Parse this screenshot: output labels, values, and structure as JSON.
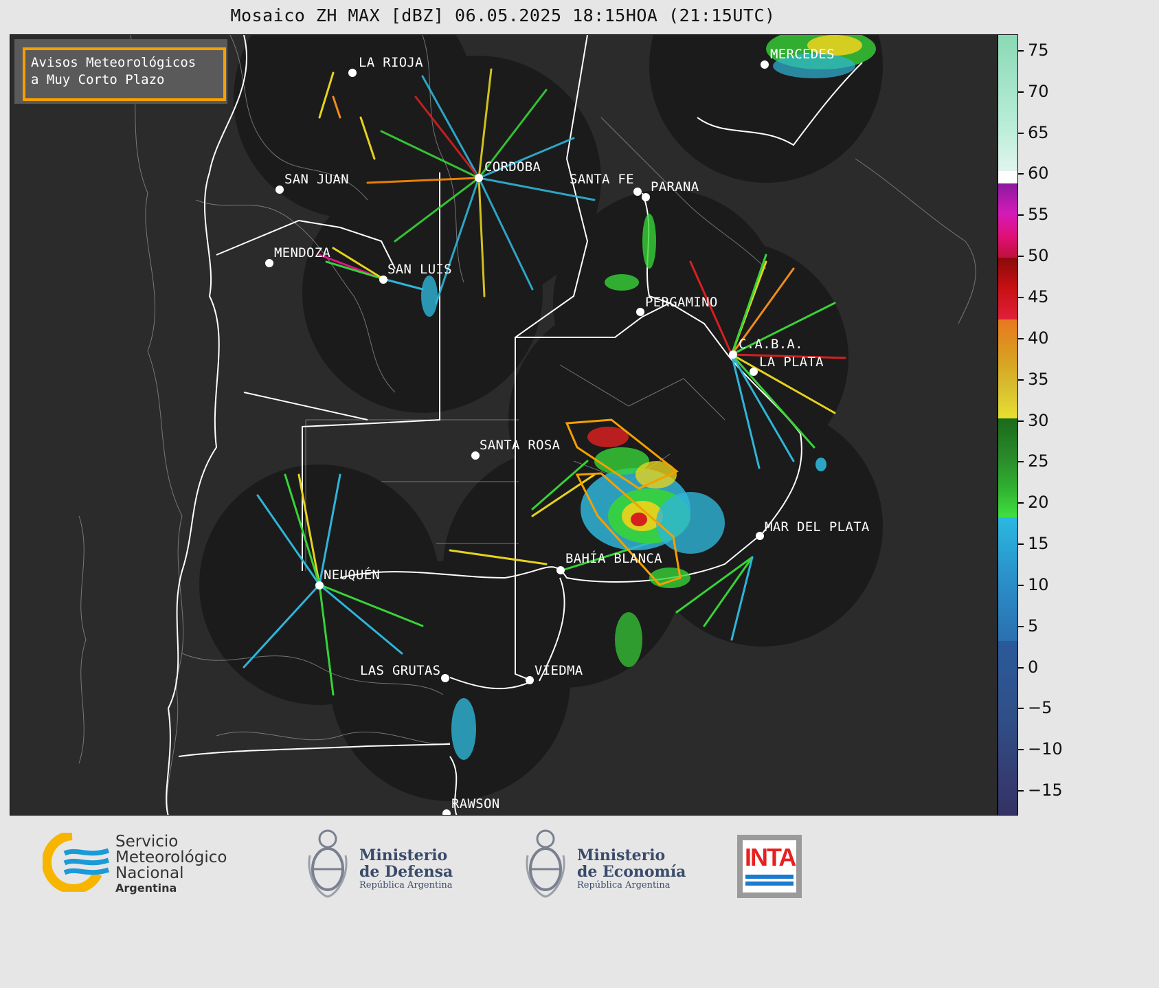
{
  "title": "Mosaico ZH MAX [dBZ] 06.05.2025 18:15HOA (21:15UTC)",
  "notice": {
    "line1": "Avisos Meteorológicos",
    "line2": "a Muy Corto Plazo"
  },
  "cities": [
    {
      "name": "LA RIOJA"
    },
    {
      "name": "MERCEDES"
    },
    {
      "name": "CORDOBA"
    },
    {
      "name": "SAN JUAN"
    },
    {
      "name": "SANTA FE"
    },
    {
      "name": "PARANA"
    },
    {
      "name": "MENDOZA"
    },
    {
      "name": "SAN LUIS"
    },
    {
      "name": "PERGAMINO"
    },
    {
      "name": "C.A.B.A."
    },
    {
      "name": "LA PLATA"
    },
    {
      "name": "SANTA ROSA"
    },
    {
      "name": "MAR DEL PLATA"
    },
    {
      "name": "BAHÍA BLANCA"
    },
    {
      "name": "NEUQUÉN"
    },
    {
      "name": "LAS GRUTAS"
    },
    {
      "name": "VIEDMA"
    },
    {
      "name": "RAWSON"
    }
  ],
  "colorbar": {
    "ticks": [
      "75",
      "70",
      "65",
      "60",
      "55",
      "50",
      "45",
      "40",
      "35",
      "30",
      "25",
      "20",
      "15",
      "10",
      "5",
      "0",
      "−5",
      "−10",
      "−15"
    ],
    "min": -18,
    "max": 77
  },
  "footer": {
    "smn_line1": "Servicio",
    "smn_line2": "Meteorológico",
    "smn_line3": "Nacional",
    "smn_country": "Argentina",
    "defensa_line1": "Ministerio",
    "defensa_line2": "de Defensa",
    "defensa_sub": "República Argentina",
    "economia_line1": "Ministerio",
    "economia_line2": "de Economía",
    "economia_sub": "República Argentina",
    "inta": "INTA"
  },
  "colors": {
    "notice_border": "#f5a000",
    "warning_polygon": "#f5a000",
    "radar_disc": "#1b1b1b",
    "map_background": "#2b2b2b"
  }
}
